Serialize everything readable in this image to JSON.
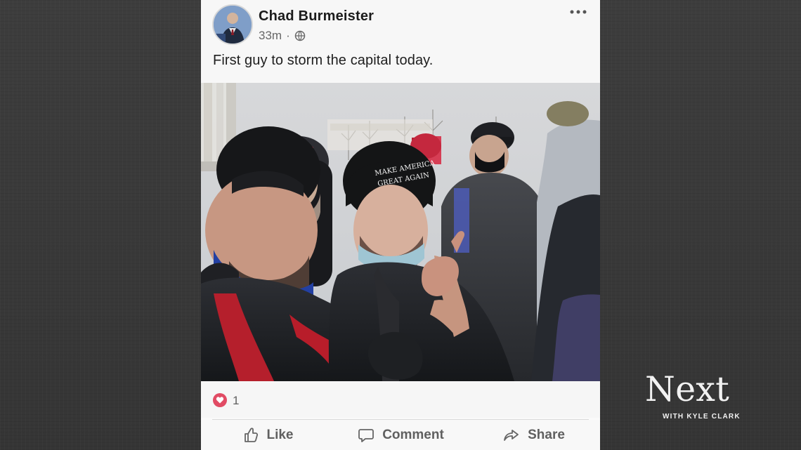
{
  "post": {
    "author": "Chad Burmeister",
    "time": "33m",
    "separator": "·",
    "privacy_icon": "globe-icon",
    "more_icon": "more-horizontal-icon",
    "text": "First guy to storm the capital today.",
    "reaction_icon": "heart-icon",
    "reaction_count": "1",
    "actions": {
      "like": "Like",
      "comment": "Comment",
      "share": "Share"
    }
  },
  "watermark": {
    "main": "Next",
    "sub": "WITH KYLE CLARK"
  },
  "colors": {
    "reaction_red": "#e14b64",
    "card_background": "#fafafa",
    "text_primary": "#1c1c1c",
    "text_secondary": "#606060"
  }
}
